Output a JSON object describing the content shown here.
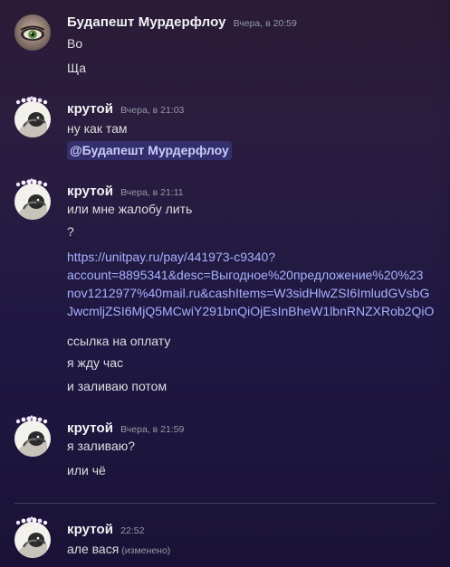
{
  "messages": [
    {
      "username": "Будапешт Мурдерфлоу",
      "timestamp": "Вчера, в 20:59",
      "lines": [
        "Во",
        "Ща"
      ]
    },
    {
      "username": "крутой",
      "timestamp": "Вчера, в 21:03",
      "lines": [
        "ну как там"
      ],
      "mention": "@Будапешт Мурдерфлоу"
    },
    {
      "username": "крутой",
      "timestamp": "Вчера, в 21:11",
      "lines": [
        "или мне жалобу лить",
        "?",
        "https://unitpay.ru/pay/441973-c9340?",
        "account=8895341&desc=Выгодное%20предложение%20%23",
        "nov1212977%40mail.ru&cashItems=W3sidHlwZSI6ImludGVsbG",
        "JwcmljZSI6MjQ5MCwiY291bnQiOjEsInBheW1lbnRNZXRob2QiO",
        "ссылка на оплату",
        "я жду час",
        "и заливаю потом"
      ]
    },
    {
      "username": "крутой",
      "timestamp": "Вчера, в 21:59",
      "lines": [
        "я заливаю?",
        "или чё"
      ]
    },
    {
      "username": "крутой",
      "timestamp": "22:52",
      "lines": [
        "але вася"
      ],
      "edited": "(изменено)"
    }
  ],
  "colors": {
    "background_top": "#2a1b36",
    "background_bottom": "#1a1236",
    "text": "#dbdee1",
    "username": "#f2f3f5",
    "timestamp": "#949ba4",
    "link": "#a7b1ff",
    "mention_bg": "#5865f2"
  },
  "icons": {
    "avatar_1": "green-eye-avatar",
    "avatar_2": "sketch-avatar",
    "decoration": "pearl-crown-decoration"
  }
}
